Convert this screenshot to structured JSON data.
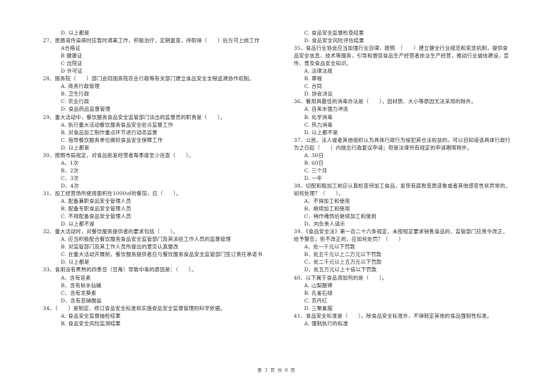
{
  "page": {
    "footer": "第 3 页 共 8 页"
  },
  "left_column": [
    {
      "type": "opt",
      "text": "D. 以上都是"
    },
    {
      "type": "q",
      "text": "27、患肠道传染病时应暂时调离工作，积极治疗，定期复查，待取得（　　）后方可上岗工作"
    },
    {
      "type": "opt",
      "text": "A合格证"
    },
    {
      "type": "opt",
      "text": "B 健康证"
    },
    {
      "type": "opt",
      "text": "C 出院证"
    },
    {
      "type": "opt",
      "text": "D 许可证"
    },
    {
      "type": "q",
      "text": "28、国务院（　　）部门会同国务院农业行政等有关部门建立食品安全全程追溯协作机制。"
    },
    {
      "type": "opt",
      "text": "A. 商务行政管理"
    },
    {
      "type": "opt",
      "text": "B. 卫生行政"
    },
    {
      "type": "opt",
      "text": "C. 农业行政"
    },
    {
      "type": "opt",
      "text": "D. 食品药品监督管理"
    },
    {
      "type": "q",
      "text": "29、重大活动中，餐饮服务食品安全监管部门派出的监督员的职责是（　　）。"
    },
    {
      "type": "opt",
      "text": "A. 执行重大活动餐饮服务食品安全驻点监督工作"
    },
    {
      "type": "opt",
      "text": "B. 对食品加工制作重点环节进行动态监督"
    },
    {
      "type": "opt",
      "text": "C. 指导餐饮服务单位做好食品安全保障工作"
    },
    {
      "type": "opt",
      "text": "D. 以上都是"
    },
    {
      "type": "q",
      "text": "30、按照市局规定，对食品批发经营者每季度至少巡查（　　）。"
    },
    {
      "type": "opt",
      "text": "A、1次"
    },
    {
      "type": "opt",
      "text": "B、2次"
    },
    {
      "type": "opt",
      "text": "C、3次"
    },
    {
      "type": "opt",
      "text": "D、4次"
    },
    {
      "type": "q",
      "text": "31、加工经营场所使用面积在1000㎡的餐馆，应（　　）。"
    },
    {
      "type": "opt",
      "text": "A. 配备兼职食品安全管理人员"
    },
    {
      "type": "opt",
      "text": "B. 配备专职食品安全管理人员"
    },
    {
      "type": "opt",
      "text": "C. 不用配备食品安全管理人员"
    },
    {
      "type": "opt",
      "text": "D. 以上都不是"
    },
    {
      "type": "q",
      "text": "32、重大活动时，对餐饮服务提供者的要求包括（　　）。"
    },
    {
      "type": "opt",
      "text": "A. 应当积极配合餐饮服务食品安全监管部门及其派驻工作人员的监督管理"
    },
    {
      "type": "opt",
      "text": "B. 对监管部门及其工作人员所提出的意见认真整改"
    },
    {
      "type": "opt",
      "text": "C. 在重大活动开展前，餐饮服务提供者应与餐饮服务食品安全监管部门签订责任承诺书"
    },
    {
      "type": "opt",
      "text": "D. 以上都是"
    },
    {
      "type": "q",
      "text": "33、食用没有煮熟的四季豆（豆角）导致中毒的原因是：（　　）。"
    },
    {
      "type": "opt",
      "text": "A、含有皂素"
    },
    {
      "type": "opt",
      "text": "B、含有秋水仙碱"
    },
    {
      "type": "opt",
      "text": "C、含有龙葵素"
    },
    {
      "type": "opt",
      "text": "D、含有亚硝酸盐"
    },
    {
      "type": "q",
      "text": "34、（　　）是制定、修订食品安全标准和实施食品安全监督管理的科学依据。"
    },
    {
      "type": "opt",
      "text": "A. 食品安全监督抽检结果"
    },
    {
      "type": "opt",
      "text": "B. 食品安全风险监测结果"
    }
  ],
  "right_column": [
    {
      "type": "opt",
      "text": "C. 食品安全监督检查结果"
    },
    {
      "type": "opt",
      "text": "D. 食品安全风险评估结果"
    },
    {
      "type": "q",
      "text": "35、食品行业协会应当加强行业自律，按照　（　　）建立健全行业规范和奖惩机制，提供食"
    },
    {
      "type": "q",
      "text": "品安全信息、技术等服务，引导和督促食品生产经营者依法生产经营，推动行业诚信建设，宣"
    },
    {
      "type": "q",
      "text": "传、普及食品安全知识。"
    },
    {
      "type": "opt",
      "text": "A. 法律法规"
    },
    {
      "type": "opt",
      "text": "B. 章程"
    },
    {
      "type": "opt",
      "text": "C. 合同"
    },
    {
      "type": "opt",
      "text": "D. 协会决议"
    },
    {
      "type": "q",
      "text": "36、餐用具最佳的消毒办法是（　　），因材质、大小等原因无法采用的除外。"
    },
    {
      "type": "opt",
      "text": "A. 自来水强力冲洗"
    },
    {
      "type": "opt",
      "text": "B. 化学消毒"
    },
    {
      "type": "opt",
      "text": "C. 热力消毒"
    },
    {
      "type": "opt",
      "text": "D. 以上都不是"
    },
    {
      "type": "q",
      "text": "37、公民、法人或者其他组织认为具体行政行为侵犯其合法权益的，可以自知道该具体行政行"
    },
    {
      "type": "q",
      "text": "为之日起（　　）内提出行政复议申请；但是法律另有规定的申请期限除外。"
    },
    {
      "type": "opt",
      "text": "A. 30日"
    },
    {
      "type": "opt",
      "text": "B. 60日"
    },
    {
      "type": "opt",
      "text": "C. 三个月"
    },
    {
      "type": "opt",
      "text": "D. 一年"
    },
    {
      "type": "q",
      "text": "38、切配和粗加工前应认真检查待加工食品，发现有腐败变质迹象或者其他感官性状异常的，"
    },
    {
      "type": "q",
      "text": "如何处理？（　　）。"
    },
    {
      "type": "opt",
      "text": "A、不得加工和使用"
    },
    {
      "type": "opt",
      "text": "B、继续加工和使用"
    },
    {
      "type": "opt",
      "text": "C、稍作掩饰后继续加工和使用"
    },
    {
      "type": "opt",
      "text": "D、向负责人请示"
    },
    {
      "type": "q",
      "text": "39、《食品安全法》第一百二十六条规定，未按规定要求销售食品的，监管部门应责令改正，"
    },
    {
      "type": "q",
      "text": "给予警告；拒不改正的，应如何处罚？（　　）"
    },
    {
      "type": "opt",
      "text": "A、处一千元以下罚款"
    },
    {
      "type": "opt",
      "text": "B、处五千元以上二万元以下罚款"
    },
    {
      "type": "opt",
      "text": "C、处二千元以上五万元以下罚款"
    },
    {
      "type": "opt",
      "text": "D、处五万元以上十倍以下罚款"
    },
    {
      "type": "q",
      "text": "40、以下属于食品添加剂的是（　　）。"
    },
    {
      "type": "opt",
      "text": "A. 山梨酸钾"
    },
    {
      "type": "opt",
      "text": "B. 孔雀石绿"
    },
    {
      "type": "opt",
      "text": "C. 苏丹红"
    },
    {
      "type": "opt",
      "text": "D. 三聚氰胺"
    },
    {
      "type": "q",
      "text": "41、食品安全标准是（　　）。除食品安全标准外，不得制定其他的食品强制性标准。"
    },
    {
      "type": "opt",
      "text": "A. 强制执行的标准"
    }
  ]
}
